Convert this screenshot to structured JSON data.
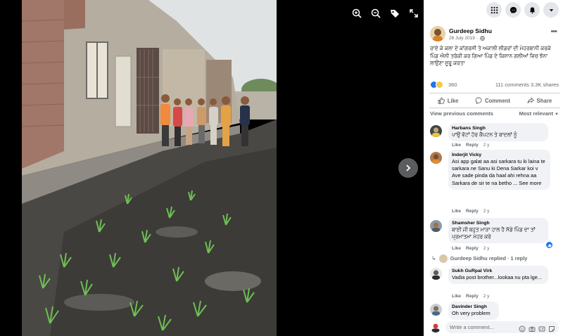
{
  "viewer": {
    "tools": [
      {
        "name": "zoom-in-icon"
      },
      {
        "name": "zoom-out-icon"
      },
      {
        "name": "tag-icon"
      },
      {
        "name": "fullscreen-icon"
      }
    ],
    "next_icon": "chevron-right-icon"
  },
  "topnav": [
    {
      "name": "menu-grid-icon"
    },
    {
      "name": "messenger-icon"
    },
    {
      "name": "notifications-bell-icon"
    },
    {
      "name": "account-caret-icon"
    }
  ],
  "post": {
    "author": "Gurdeep Sidhu",
    "date": "26 July 2019 · ",
    "text": "ਰਾਏ ਕੇ ਕਲਾ ਦੇ ਕਾਂਗਰਸੀ ਤੇ ਅਕਾਲੀ ਲੀਡਰਾਂ ਦੀ ਮੇਹਰਬਾਨੀ ਕਰਕੇ ਪਿੰਡ ਐਨੀ ਤਰੱਕੀ ਕਰ ਗਿਆ ਪਿੰਡ ਦੇ ਕਿਸਾਨ ਗਲੀਆਂ ਵਿਚ ਝੋਨਾ ਲਾਉਣਾ ਸੂਰੂ ਕਰਤਾ",
    "reaction_count": "360",
    "stats": "111 comments  3.3K shares"
  },
  "actions": {
    "like": "Like",
    "comment": "Comment",
    "share": "Share"
  },
  "comments_bar": {
    "previous": "View previous comments",
    "sort": "Most relevant"
  },
  "comments": [
    {
      "name": "Harbans Singh",
      "text": "ਪਾਉ ਵੋਟਾਂ ਹੋਰ ਕੈਪਟਨ ਤੇ ਬਾਦਲਾਂ ਨੂੰ",
      "like": "Like",
      "reply": "Reply",
      "time": "2 y"
    },
    {
      "name": "Inderjit Vicky",
      "text": "Asi app galat aa asi sarkara tu ki laina te sarkara ne Sanu ki Dena Sarkar koi v Ave sade pinda da haal ahi rehna aa Sarkara de sir te na betho ... See more",
      "like": "Like",
      "reply": "Reply",
      "time": "2 y"
    },
    {
      "name": "Shamsher Singh",
      "text": "ਬਾਈ ਜੀ ਬਹੁਤ ਮਾੜਾ ਹਾਲ ਹੈ ਸੋਡੇ ਪਿੰਡ ਦਾ ਤਾਂ ਪ੍ਰਮਾਤਮਾ ਮੇਹਰ ਕਰੇ",
      "like": "Like",
      "reply": "Reply",
      "time": "2 y"
    },
    {
      "name": "Sukh GuRpal Virk",
      "text": "Vadia post brother...lookaa nu pta lge...",
      "like": "Like",
      "reply": "Reply",
      "time": "2 y"
    },
    {
      "name": "Davinder Singh",
      "text": "Oh very problem",
      "like": "",
      "reply": "",
      "time": ""
    }
  ],
  "reply_summary": {
    "text": "Gurdeep Sidhu replied · 1 reply"
  },
  "write_comment": {
    "placeholder": "Write a comment..."
  },
  "colors": {
    "accent": "#1877f2",
    "panel_bg": "#ffffff",
    "bubble_bg": "#f0f2f5",
    "muted_text": "#65676b"
  }
}
